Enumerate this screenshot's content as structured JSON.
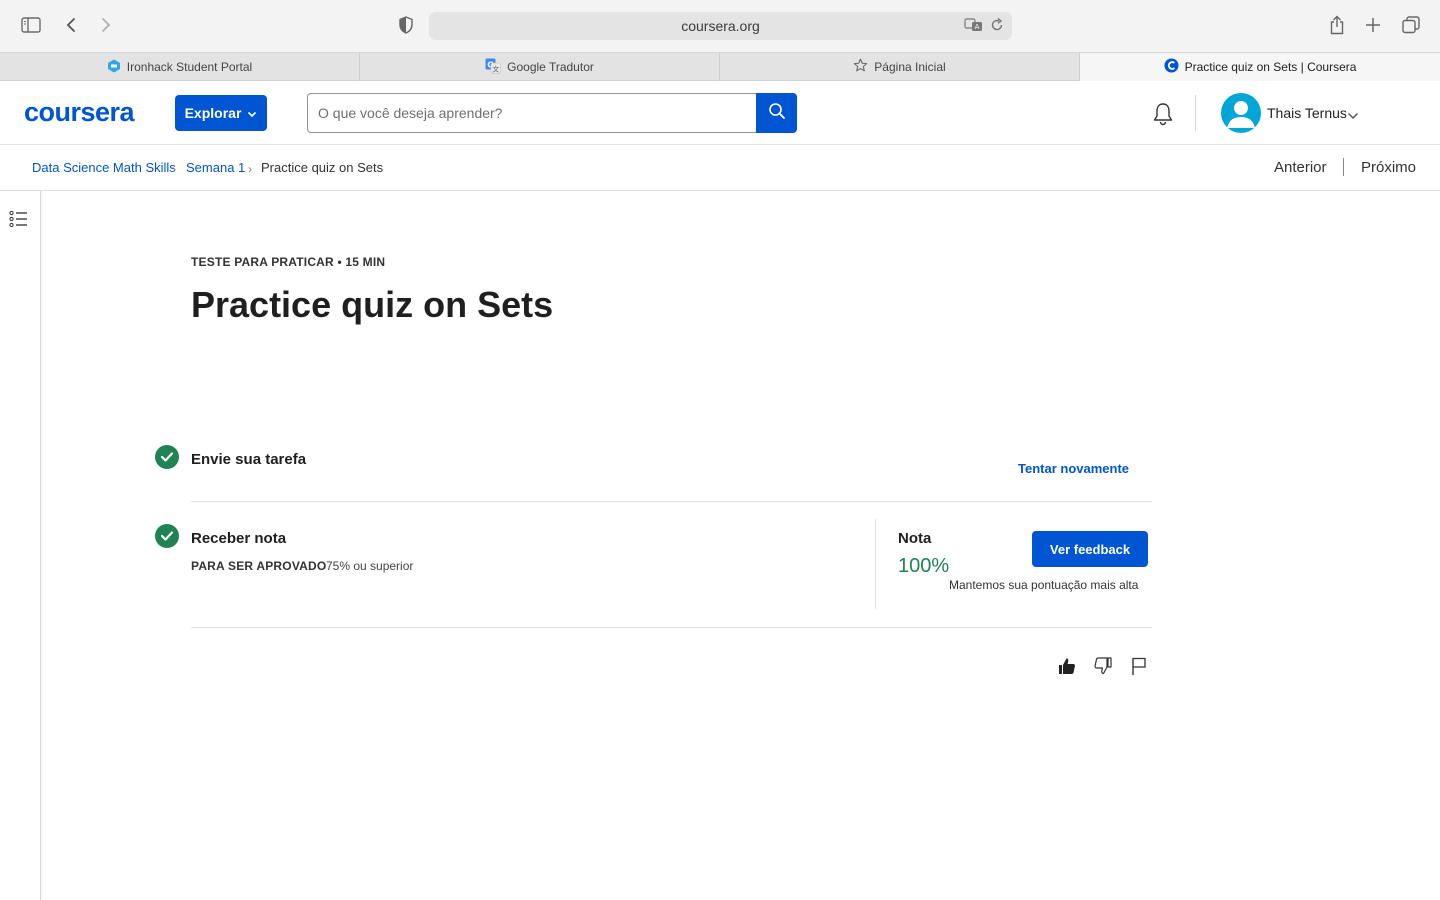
{
  "browser": {
    "url": "coursera.org",
    "tabs": [
      {
        "label": "Ironhack Student Portal",
        "icon": "ironhack-icon"
      },
      {
        "label": "Google Tradutor",
        "icon": "google-translate-icon"
      },
      {
        "label": "Página Inicial",
        "icon": "star-icon"
      },
      {
        "label": "Practice quiz on Sets | Coursera",
        "icon": "coursera-icon",
        "active": true
      }
    ]
  },
  "header": {
    "logo": "coursera",
    "explore_label": "Explorar",
    "search_placeholder": "O que você deseja aprender?",
    "user_name": "Thais Ternus"
  },
  "breadcrumb": {
    "items": [
      "Data Science Math Skills",
      "Semana 1",
      "Practice quiz on Sets"
    ],
    "prev_label": "Anterior",
    "next_label": "Próximo"
  },
  "quiz": {
    "eyebrow": "TESTE PARA PRATICAR • 15 MIN",
    "title": "Practice quiz on Sets",
    "step1_title": "Envie sua tarefa",
    "retry_label": "Tentar novamente",
    "step2_title": "Receber nota",
    "pass_label": "PARA SER APROVADO",
    "pass_value": "75% ou superior",
    "grade_label": "Nota",
    "grade_value": "100%",
    "grade_note": "Mantemos sua pontuação mais alta",
    "feedback_label": "Ver feedback"
  },
  "colors": {
    "brand": "#0056d2",
    "success": "#1f8354",
    "avatar": "#00a6d6"
  }
}
